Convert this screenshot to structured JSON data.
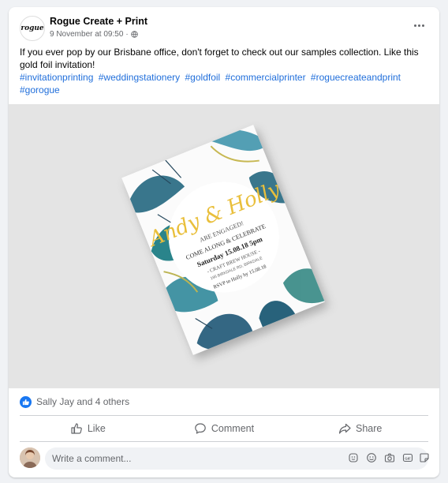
{
  "post": {
    "author": "Rogue Create + Print",
    "timestamp": "9 November at 09:50",
    "privacy_sep": "·",
    "text": "If you ever pop by our Brisbane office, don't forget to check out our samples collection. Like this gold foil invitation!",
    "hashtags": [
      "#invitationprinting",
      "#weddingstationery",
      "#goldfoil",
      "#commercialprinter",
      "#roguecreateandprint",
      "#gorogue"
    ],
    "avatar_text": "rogue"
  },
  "image": {
    "names": "Andy & Holly",
    "line1": "ARE ENGAGED!",
    "line2": "COME ALONG & CELEBRATE",
    "line3": "Saturday 15.08.18 5pm",
    "line4": "- CRAFT BREW HOUSE -",
    "line5": "195 BIRKDALE RD, BIRKDALE",
    "line6": "RSVP to Holly by 15.08.18"
  },
  "reactions": {
    "summary": "Sally Jay and 4 others"
  },
  "actions": {
    "like": "Like",
    "comment": "Comment",
    "share": "Share"
  },
  "composer": {
    "placeholder": "Write a comment..."
  },
  "colors": {
    "accent": "#1877f2",
    "link": "#216fdb",
    "gold": "#e9bf3b"
  }
}
